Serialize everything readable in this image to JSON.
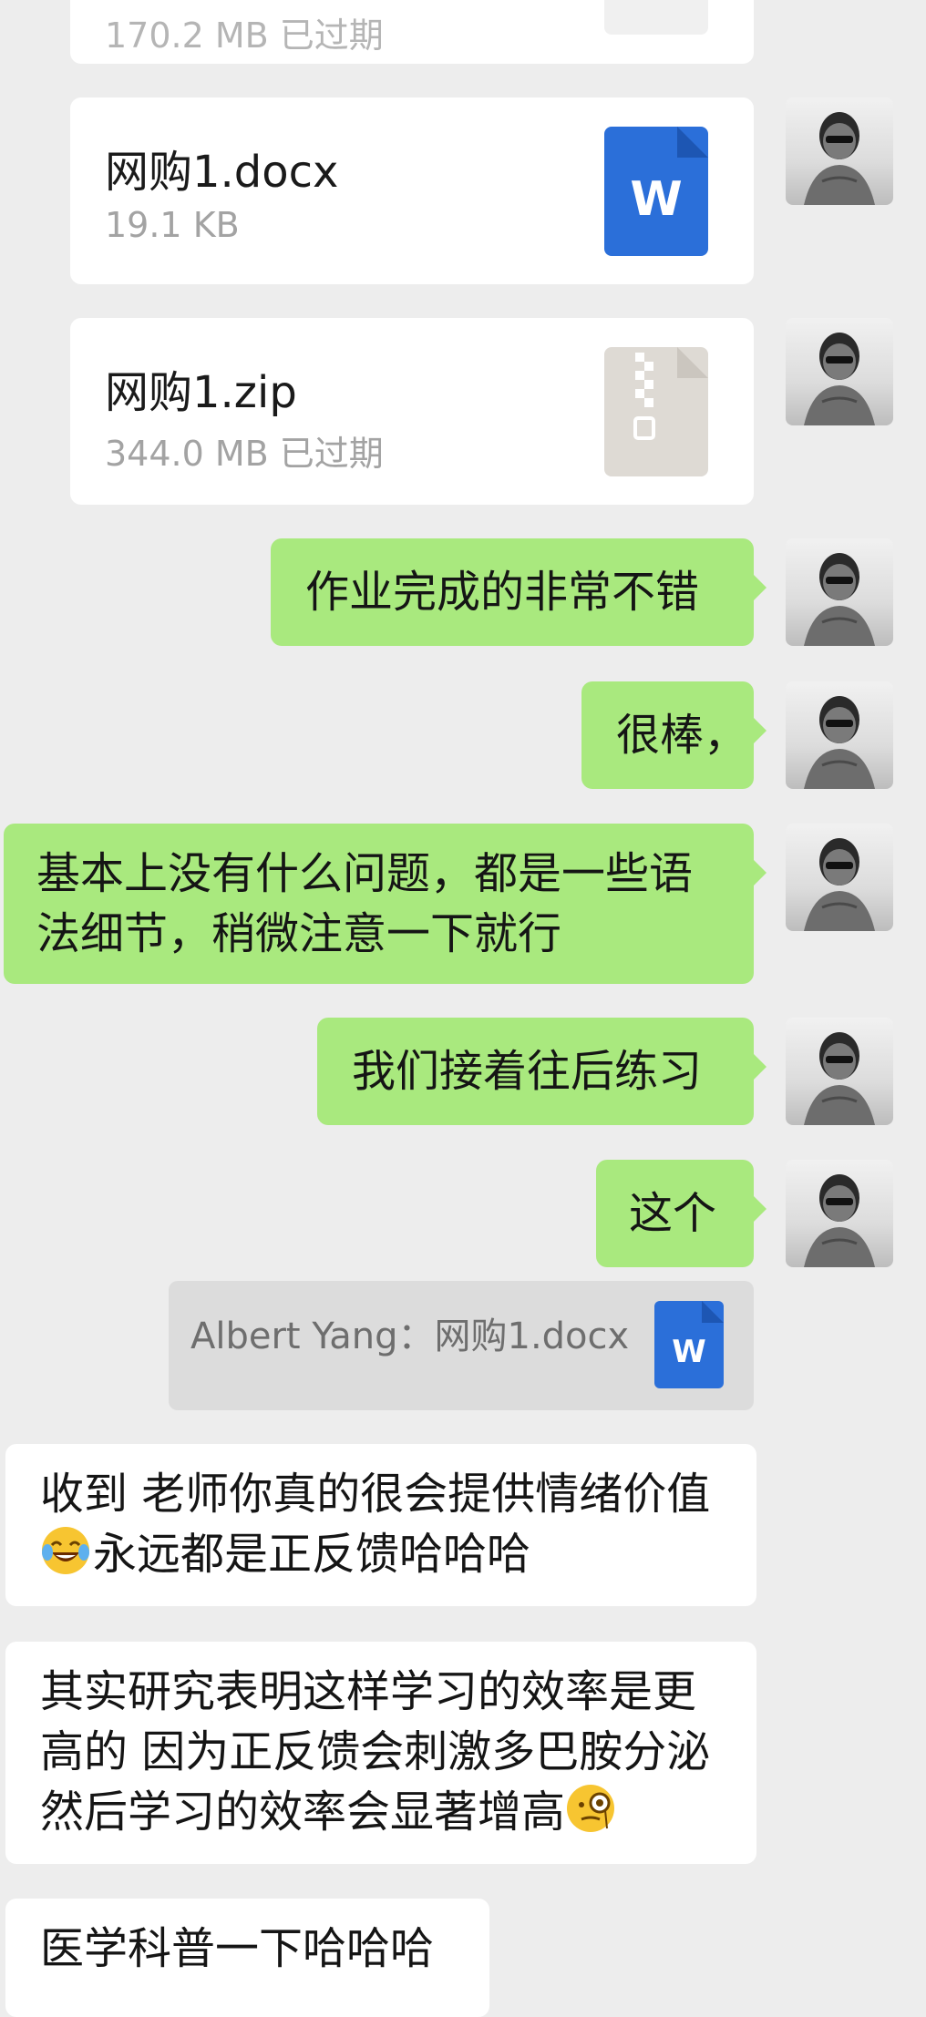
{
  "files": [
    {
      "name": "",
      "meta": "170.2 MB 已过期",
      "icon": "expired-file-icon"
    },
    {
      "name": "网购1.docx",
      "meta": "19.1 KB",
      "icon": "word-doc-icon",
      "icon_letter": "W",
      "color": "#2b6fd9"
    },
    {
      "name": "网购1.zip",
      "meta": "344.0 MB 已过期",
      "icon": "zip-archive-icon",
      "color": "#dedad4"
    }
  ],
  "messages": [
    {
      "side": "right",
      "text": "作业完成的非常不错"
    },
    {
      "side": "right",
      "text": "很棒，"
    },
    {
      "side": "right",
      "text_line1": "基本上没有什么问题，都是一些语",
      "text_line2": "法细节，稍微注意一下就行"
    },
    {
      "side": "right",
      "text": "我们接着往后练习"
    },
    {
      "side": "right",
      "text": "这个"
    }
  ],
  "quote": {
    "text": "Albert Yang：网购1.docx",
    "icon_letter": "W"
  },
  "replies": [
    {
      "line1": "收到 老师你真的很会提供情绪价值",
      "line2": "永远都是正反馈哈哈哈",
      "emoji": "tears-of-joy-emoji"
    },
    {
      "line1": "其实研究表明这样学习的效率是更",
      "line2": "高的 因为正反馈会刺激多巴胺分泌",
      "line3": "然后学习的效率会显著增高",
      "emoji": "monocle-emoji"
    },
    {
      "line1": "医学科普一下哈哈哈"
    }
  ],
  "colors": {
    "bubble_green": "#a9e97e",
    "background": "#ededed",
    "word_blue": "#2b6fd9"
  }
}
